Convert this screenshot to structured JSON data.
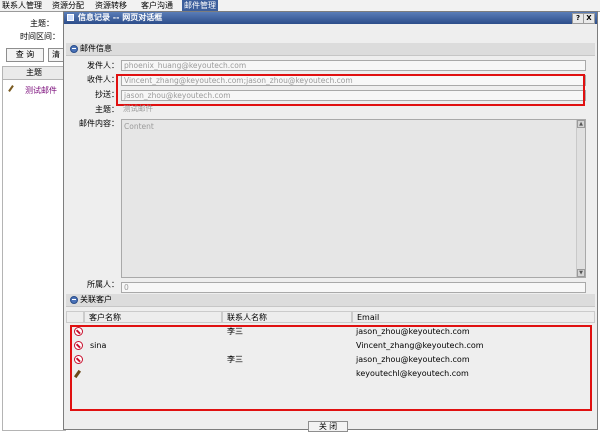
{
  "menubar": {
    "items": [
      {
        "label": "联系人管理"
      },
      {
        "label": "资源分配"
      },
      {
        "label": "资源转移"
      },
      {
        "label": "客户沟通"
      },
      {
        "label": "邮件管理"
      }
    ]
  },
  "background": {
    "subject_label": "主题：",
    "time_label": "时间区间：",
    "query_button": "查 询",
    "clear_button": "清",
    "list_header": "主题",
    "list_item": "测试邮件"
  },
  "dialog": {
    "title": "信息记录 -- 网页对话框",
    "help_btn": "?",
    "close_btn": "X",
    "mail_section": "邮件信息",
    "fields": {
      "sender_label": "发件人：",
      "sender_value": "phoenix_huang@keyoutech.com",
      "recipient_label": "收件人：",
      "recipient_value": "Vincent_zhang@keyoutech.com;jason_zhou@keyoutech.com",
      "cc_label": "抄送：",
      "cc_value": "jason_zhou@keyoutech.com",
      "subject_label": "主题：",
      "subject_value": "测试邮件",
      "content_label": "邮件内容：",
      "content_value": "Content",
      "owner_label": "所属人：",
      "owner_value": "0"
    },
    "customers_section": "关联客户",
    "table": {
      "headers": [
        "客户名称",
        "联系人名称",
        "Email"
      ],
      "rows": [
        {
          "icon": "delete-icon",
          "customer": "",
          "contact": "李三",
          "email": "jason_zhou@keyoutech.com"
        },
        {
          "icon": "delete-icon",
          "customer": "sina",
          "contact": "",
          "email": "Vincent_zhang@keyoutech.com"
        },
        {
          "icon": "delete-icon",
          "customer": "",
          "contact": "李三",
          "email": "jason_zhou@keyoutech.com"
        },
        {
          "icon": "edit-icon",
          "customer": "",
          "contact": "",
          "email": "keyoutechl@keyoutech.com"
        }
      ]
    },
    "close_button": "关 闭"
  },
  "colors": {
    "title_bar": "#2c4d8a",
    "highlight_box": "#e01010",
    "active_menu": "#3d5f9c"
  }
}
